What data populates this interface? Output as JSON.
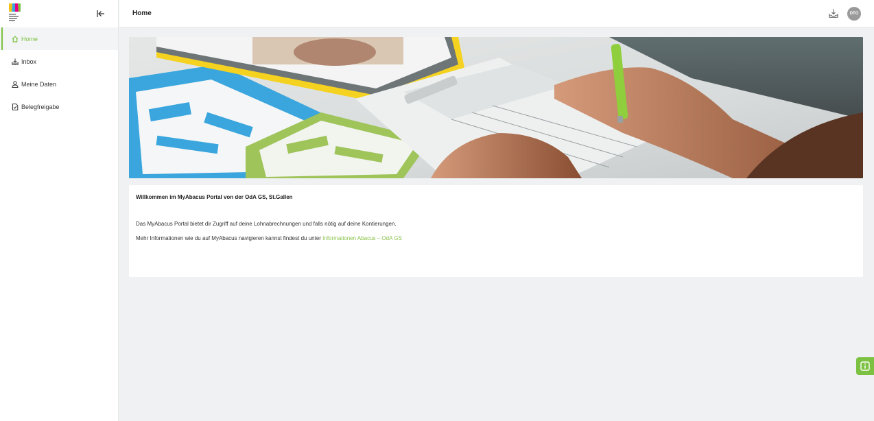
{
  "header": {
    "title": "Home",
    "avatar_initials": "DTO"
  },
  "sidebar": {
    "items": [
      {
        "label": "Home",
        "icon": "home-icon",
        "active": true
      },
      {
        "label": "Inbox",
        "icon": "inbox-icon",
        "active": false
      },
      {
        "label": "Meine Daten",
        "icon": "user-icon",
        "active": false
      },
      {
        "label": "Belegfreigabe",
        "icon": "document-check-icon",
        "active": false
      }
    ]
  },
  "main": {
    "welcome_title": "Willkommen im MyAbacus Portal von der OdA GS, St.Gallen",
    "paragraph1": "Das MyAbacus Portal bietet dir Zugriff auf deine Lohnabrechnungen und falls nötig auf deine Kontierungen.",
    "paragraph2_prefix": "Mehr Informationen wie du auf MyAbacus navigieren kannst findest du unter ",
    "link_text": "Informationen Abacus – OdA GS"
  },
  "colors": {
    "accent": "#7cc142",
    "link": "#8bc34a",
    "avatar_bg": "#9a9a9a"
  }
}
